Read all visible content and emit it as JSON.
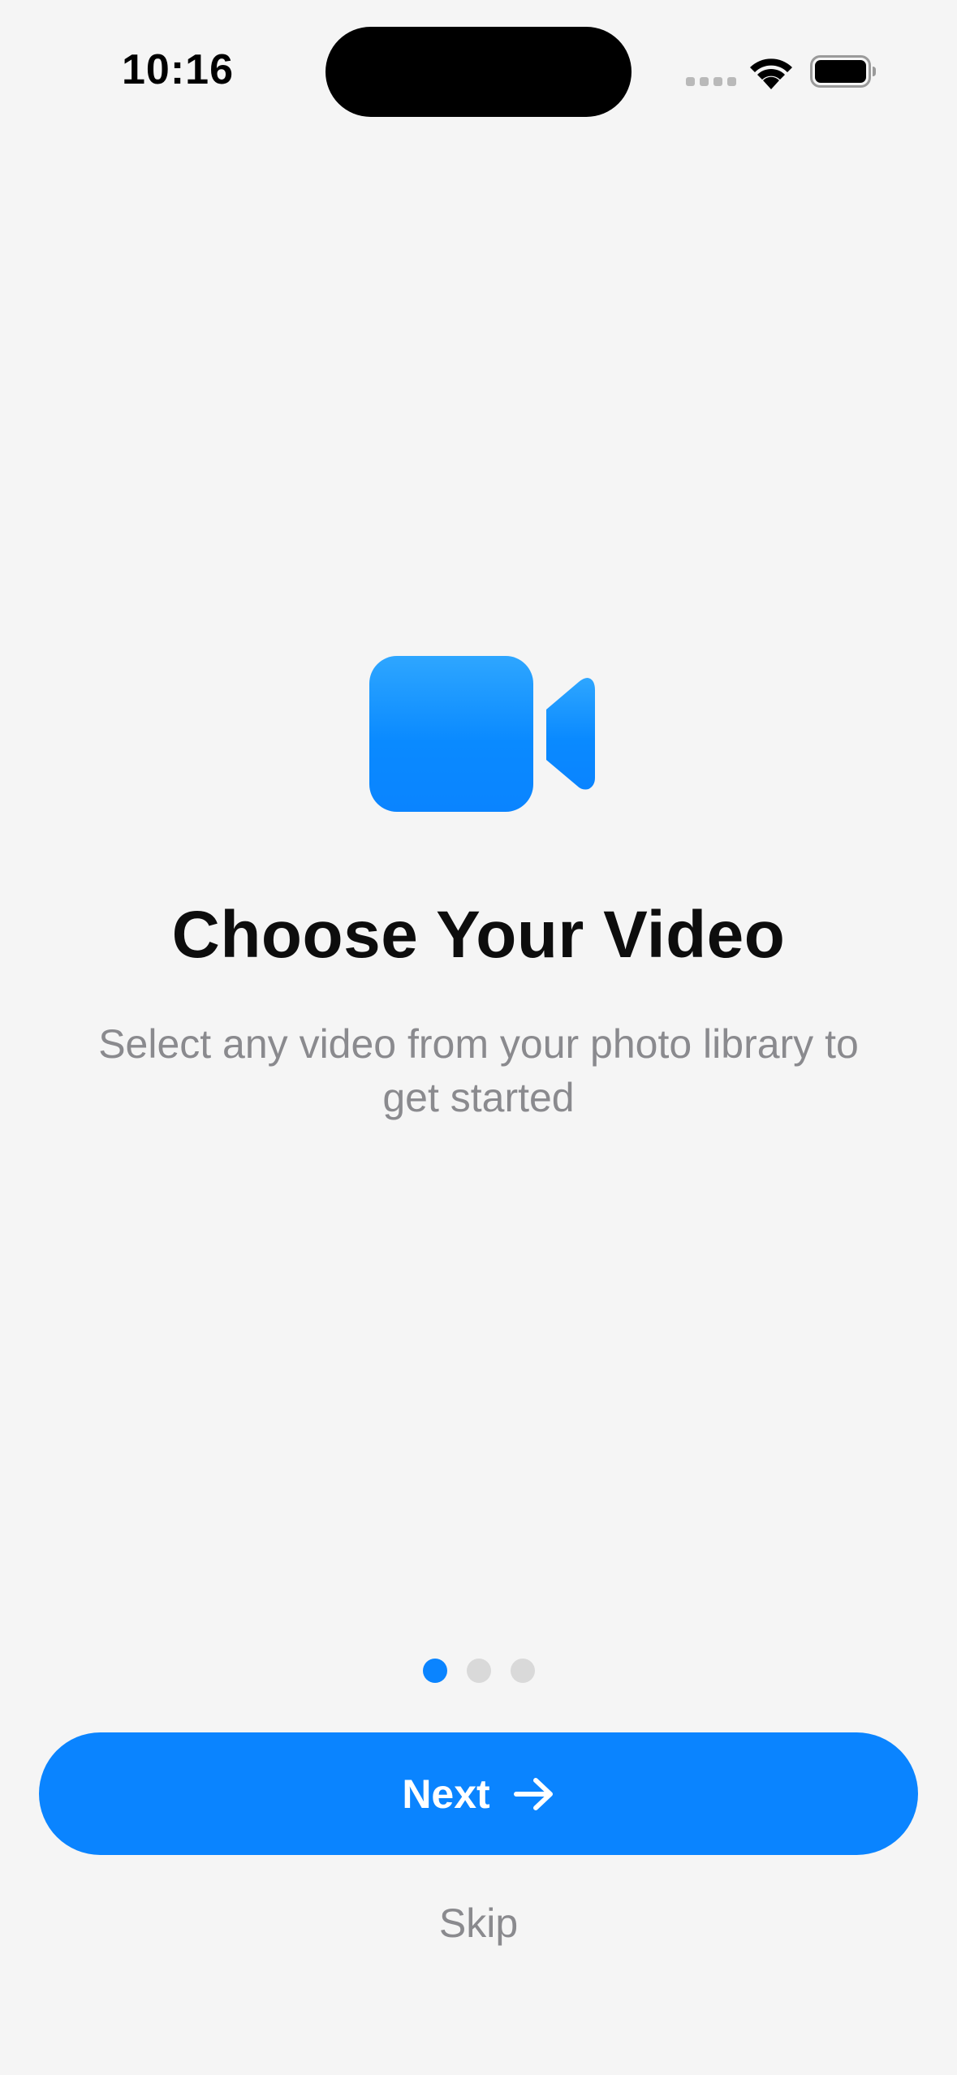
{
  "status_bar": {
    "time": "10:16",
    "icons": [
      "cellular-signal-icon",
      "wifi-icon",
      "battery-icon"
    ]
  },
  "onboarding": {
    "icon": "video-camera-icon",
    "title": "Choose Your Video",
    "subtitle": "Select any video from your photo library to get started",
    "page_count": 3,
    "current_page": 1
  },
  "actions": {
    "next_label": "Next",
    "skip_label": "Skip"
  },
  "colors": {
    "accent": "#0a84ff",
    "background": "#f5f5f5",
    "title": "#0d0d0d",
    "secondary_text": "#8a8a8e",
    "inactive_dot": "#d9d9d9"
  }
}
